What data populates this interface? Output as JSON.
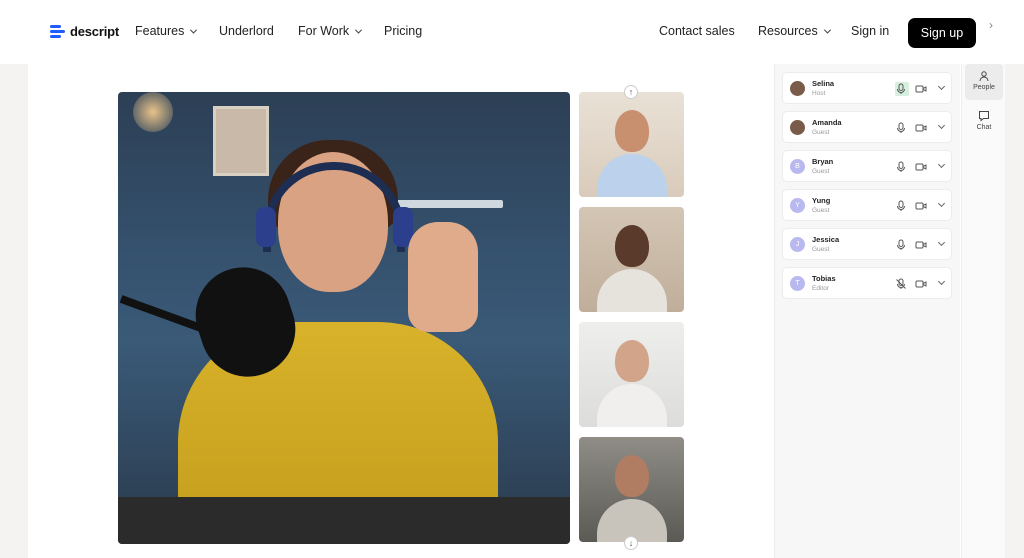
{
  "nav": {
    "logo_text": "descript",
    "features_label": "Features",
    "underlord_label": "Underlord",
    "forwork_label": "For Work",
    "pricing_label": "Pricing",
    "contact_label": "Contact sales",
    "resources_label": "Resources",
    "signin_label": "Sign in",
    "signup_label": "Sign up"
  },
  "colors": {
    "brand": "#1f5cff",
    "signup_bg": "#000000",
    "mic_active": "#d6f0dd",
    "avatar": "#b9b9f0"
  },
  "participants": [
    {
      "name": "Selina",
      "role": "Host",
      "initial": "",
      "mic": "mic-active-icon",
      "camera": "video-icon"
    },
    {
      "name": "Amanda",
      "role": "Guest",
      "initial": "",
      "mic": "mic-icon",
      "camera": "video-icon"
    },
    {
      "name": "Bryan",
      "role": "Guest",
      "initial": "B",
      "mic": "mic-icon",
      "camera": "video-icon"
    },
    {
      "name": "Yung",
      "role": "Guest",
      "initial": "Y",
      "mic": "mic-icon",
      "camera": "video-icon"
    },
    {
      "name": "Jessica",
      "role": "Guest",
      "initial": "J",
      "mic": "mic-icon",
      "camera": "video-icon"
    },
    {
      "name": "Tobias",
      "role": "Editor",
      "initial": "T",
      "mic": "mic-muted-icon",
      "camera": "video-icon"
    }
  ],
  "rail": {
    "people_label": "People",
    "chat_label": "Chat"
  }
}
